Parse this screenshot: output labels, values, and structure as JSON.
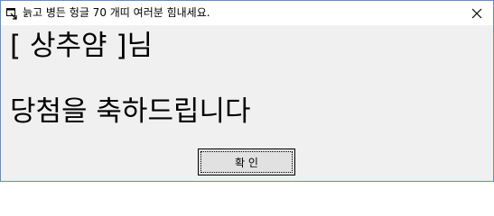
{
  "window": {
    "title": "늙고 병든 헝글 70 개띠 여러분 힘내세요.",
    "close_glyph": "close-icon"
  },
  "message": {
    "line1": "[ 상추얌 ]님",
    "line2": "당첨을 축하드립니다"
  },
  "buttons": {
    "ok_label": "확 인"
  },
  "colors": {
    "window_border": "#6b8db6",
    "titlebar_bg": "#ffffff",
    "client_bg": "#f0f0f0",
    "button_bg": "#e1e1e1"
  },
  "icons": [
    "app-window-icon",
    "close-icon"
  ]
}
